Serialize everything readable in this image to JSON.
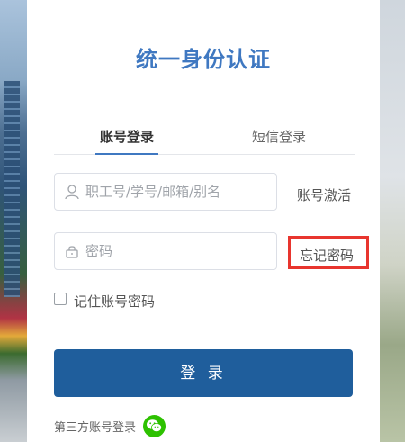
{
  "title": "统一身份认证",
  "tabs": [
    {
      "label": "账号登录",
      "active": true
    },
    {
      "label": "短信登录",
      "active": false
    }
  ],
  "form": {
    "username_placeholder": "职工号/学号/邮箱/别名",
    "username_value": "",
    "password_placeholder": "密码",
    "password_value": "",
    "activate_link": "账号激活",
    "forgot_link": "忘记密码",
    "remember_label": "记住账号密码",
    "remember_checked": false,
    "submit_label": "登 录"
  },
  "third_party": {
    "label": "第三方账号登录",
    "providers": [
      {
        "icon": "wechat-icon",
        "color": "#2dc100"
      }
    ]
  },
  "colors": {
    "accent": "#3f78c1",
    "button": "#1f5e9c",
    "highlight_border": "#e8352e"
  }
}
